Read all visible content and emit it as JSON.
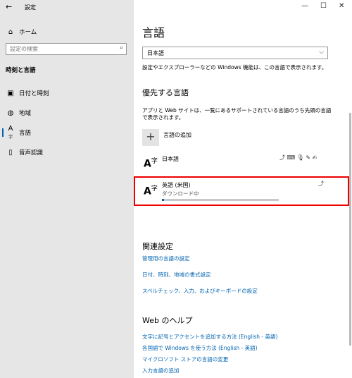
{
  "window": {
    "title": "設定",
    "back_glyph": "←",
    "minimize_glyph": "—",
    "maximize_glyph": "☐",
    "close_glyph": "✕"
  },
  "sidebar": {
    "home": {
      "label": "ホーム",
      "icon": "home-icon"
    },
    "search_placeholder": "設定の検索",
    "section_title": "時刻と言語",
    "items": [
      {
        "label": "日付と時刻",
        "icon": "calendar-clock-icon",
        "glyph": "▣"
      },
      {
        "label": "地域",
        "icon": "globe-icon",
        "glyph": "◍"
      },
      {
        "label": "言語",
        "icon": "language-icon",
        "glyph": "A"
      },
      {
        "label": "音声認識",
        "icon": "microphone-icon",
        "glyph": "🎙"
      }
    ],
    "active_index": 2
  },
  "main": {
    "title": "言語",
    "display_language": {
      "value": "日本語",
      "note": "設定やエクスプローラーなどの Windows 機能は、この言語で表示されます。"
    },
    "preferred": {
      "heading": "優先する言語",
      "description": "アプリと Web サイトは、一覧にあるサポートされている言語のうち先頭の言語で表示されます。",
      "add_label": "言語の追加",
      "languages": [
        {
          "name": "日本語",
          "status": "",
          "feature_icons": "⤴ ⌨ 🎙 ✎ ✍"
        },
        {
          "name": "英語 (米国)",
          "status": "ダウンロード中",
          "feature_icons": "⤴",
          "progress": 0.02
        }
      ]
    },
    "related": {
      "heading": "関連設定",
      "links": [
        "管理用の言語の設定",
        "日付、時刻、地域の書式設定",
        "スペルチェック、入力、およびキーボードの設定"
      ]
    },
    "help": {
      "heading": "Web のヘルプ",
      "links": [
        "文字に記号とアクセントを追加する方法 (English - 英語)",
        "各国語で Windows を使う方法 (English - 英語)",
        "マイクロソフト ストアの言語の変更",
        "入力言語の追加"
      ]
    }
  }
}
